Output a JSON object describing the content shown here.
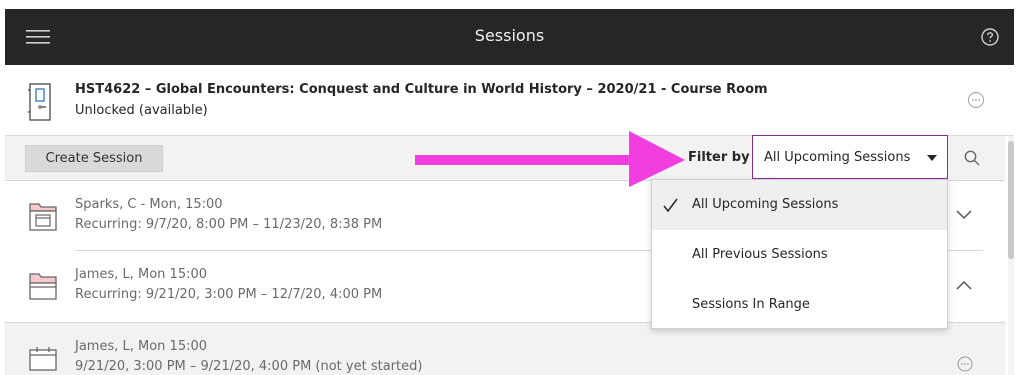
{
  "header": {
    "title": "Sessions",
    "menu_icon": "hamburger-menu-icon",
    "help_icon": "help-icon"
  },
  "course": {
    "title": "HST4622 – Global Encounters: Conquest and Culture in World History – 2020/21 - Course Room",
    "status": "Unlocked (available)",
    "icon": "door-icon"
  },
  "toolbar": {
    "create_label": "Create Session",
    "filter_label": "Filter by",
    "filter_value": "All Upcoming Sessions",
    "accent_color": "#8d2c8f",
    "arrow_color": "#f23ddf"
  },
  "filter_options": [
    {
      "label": "All Upcoming Sessions",
      "selected": true
    },
    {
      "label": "All Previous Sessions",
      "selected": false
    },
    {
      "label": "Sessions In Range",
      "selected": false
    }
  ],
  "sessions": [
    {
      "name": "Sparks, C - Mon, 15:00",
      "time": "Recurring: 9/7/20, 8:00 PM – 11/23/20, 8:38 PM",
      "icon": "recurring-folder-icon",
      "control": "chevron-down-icon"
    },
    {
      "name": "James, L, Mon 15:00",
      "time": "Recurring: 9/21/20, 3:00 PM – 12/7/20, 4:00 PM",
      "icon": "open-folder-icon",
      "control": "chevron-up-icon"
    },
    {
      "name": "James, L, Mon 15:00",
      "time": "9/21/20, 3:00 PM – 9/21/20, 4:00 PM (not yet started)",
      "icon": "calendar-icon",
      "control": "more-options-icon"
    }
  ]
}
